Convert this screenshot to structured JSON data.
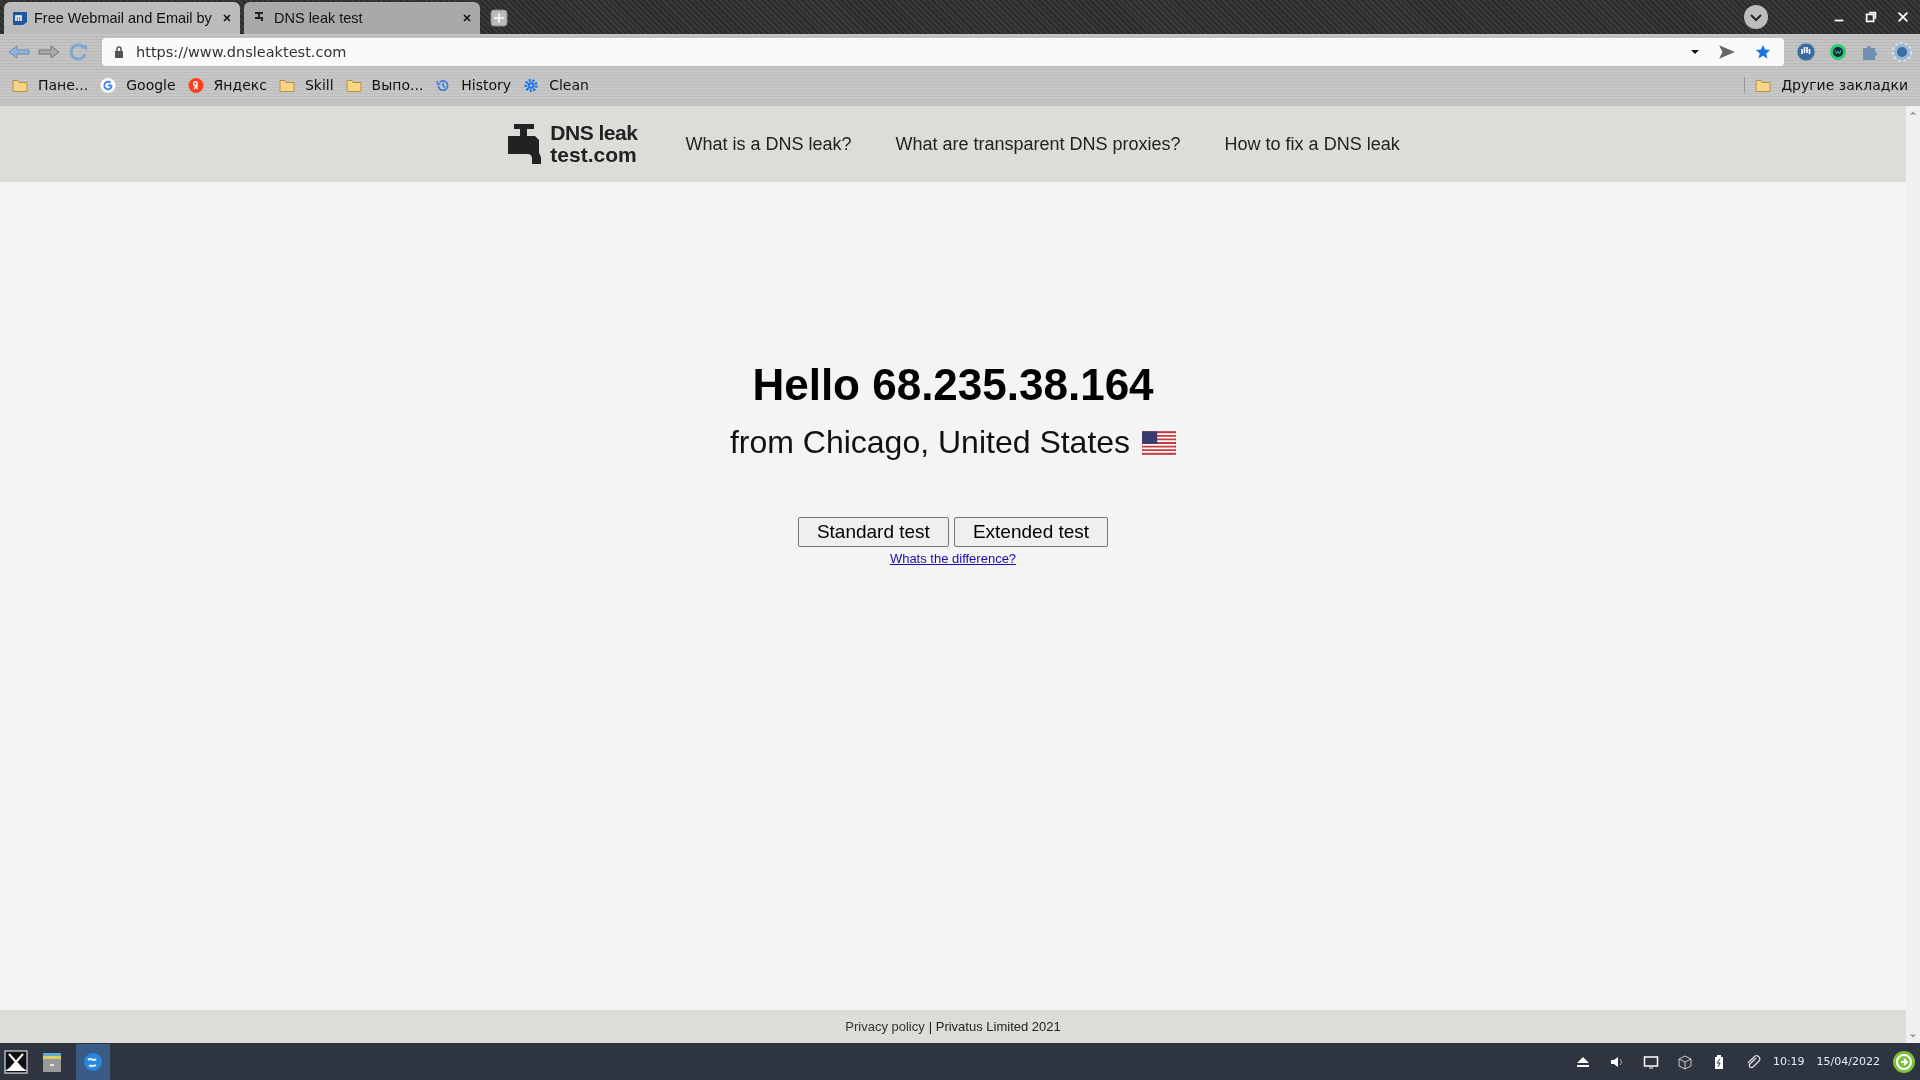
{
  "tabs": [
    {
      "title": "Free Webmail and Email by",
      "selected": false,
      "kind": "mail"
    },
    {
      "title": "DNS leak test",
      "selected": true,
      "kind": "tap"
    }
  ],
  "address_bar": {
    "url": "https://www.dnsleaktest.com"
  },
  "bookmarks": [
    {
      "label": "Пане...",
      "kind": "folder"
    },
    {
      "label": "Google",
      "kind": "google"
    },
    {
      "label": "Яндекс",
      "kind": "yandex"
    },
    {
      "label": "Skill",
      "kind": "folder"
    },
    {
      "label": "Выпо...",
      "kind": "folder"
    },
    {
      "label": "History",
      "kind": "history"
    },
    {
      "label": "Clean",
      "kind": "gear"
    }
  ],
  "other_bookmarks": "Другие закладки",
  "site": {
    "logo": [
      "DNS leak",
      "test.com"
    ],
    "nav": [
      "What is a DNS leak?",
      "What are transparent DNS proxies?",
      "How to fix a DNS leak"
    ],
    "greeting": "Hello 68.235.38.164",
    "location": "from Chicago, United States",
    "buttons": [
      "Standard test",
      "Extended test"
    ],
    "difference_link": "Whats the difference?",
    "footer": {
      "link": "Privacy policy",
      "text": "| Privatus Limited 2021"
    }
  },
  "taskbar": {
    "time": "10:19",
    "date": "15/04/2022"
  }
}
